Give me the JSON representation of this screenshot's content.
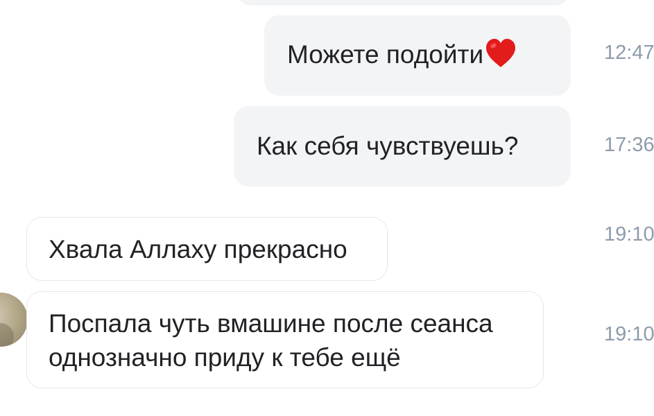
{
  "messages": [
    {
      "text": "Можете подойти",
      "emoji": "❤️",
      "time": "12:47",
      "direction": "outgoing"
    },
    {
      "text": "Как себя чувствуешь?",
      "time": "17:36",
      "direction": "outgoing"
    },
    {
      "text": "Хвала Аллаху прекрасно",
      "time": "19:10",
      "direction": "incoming"
    },
    {
      "text_line1": "Поспала чуть вмашине после сеанса",
      "text_line2": "однозначно приду к тебе ещё",
      "time": "19:10",
      "direction": "incoming"
    }
  ],
  "icons": {
    "emoji": "red-heart-icon",
    "avatar": "user-avatar"
  },
  "colors": {
    "outgoing_bubble": "#f3f4f6",
    "incoming_border": "#e4e6ea",
    "text": "#222226",
    "timestamp": "#8e9bab",
    "heart": "#e21b1b"
  }
}
